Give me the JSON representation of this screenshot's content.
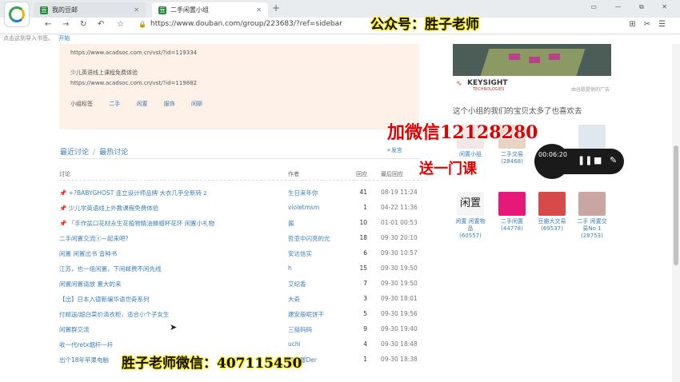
{
  "browser": {
    "tabs": [
      {
        "label": "我的豆邮",
        "favicon": "豆"
      },
      {
        "label": "二手闲置小组",
        "favicon": "豆"
      }
    ],
    "new_tab": "+",
    "window_controls": "▭ — ⧉ ✕",
    "url": "https://www.douban.com/group/223683/?ref=sidebar",
    "bookmarks_hint": "点击这到导入书签。",
    "bookmarks_start": "开始"
  },
  "promo": {
    "line1": "https://www.acadsoc.com.cn/vst/?id=119334",
    "line2": "少儿英语线上课程免费体验",
    "line3": "https://www.acadsoc.com.cn/vst/?id=119882",
    "tags_label": "小组标签",
    "tags": [
      "二手",
      "闲置",
      "服饰",
      "闲聊"
    ]
  },
  "post_link": "+发言",
  "discussions": {
    "tab_recent": "最近讨论",
    "tab_hot": "最热讨论",
    "columns": {
      "title": "讨论",
      "author": "作者",
      "replies": "回应",
      "last": "最后回应"
    },
    "rows": [
      {
        "title": "📌 +?BABYGHOST 连立设计师品牌 大衣几乎全新转 z",
        "author": "生日来年你",
        "replies": "41",
        "time": "08-19 11:24"
      },
      {
        "title": "📌 少儿学英语线上外教课程免费体验",
        "author": "violetmsm",
        "replies": "1",
        "time": "04-22 11:36"
      },
      {
        "title": "📌 「手作盆口花材永生花植物精油蜂蜡杯花环 闲置小礼物",
        "author": "酱",
        "replies": "10",
        "time": "01-01 00:53"
      },
      {
        "title": "二手闲置交流ⓧ—起来吧?",
        "author": "哲亚中闪亮的光",
        "replies": "18",
        "time": "09-30 20:10"
      },
      {
        "title": "闲置 闲置出书 音种书",
        "author": "安达信实",
        "replies": "6",
        "time": "09-30 10:57"
      },
      {
        "title": "江苏，也一组闲置，下闲邮费不闲先线",
        "author": "h",
        "replies": "15",
        "time": "09-30 19:50"
      },
      {
        "title": "闲置闲置请放 置大的来",
        "author": "艾纪香",
        "replies": "7",
        "time": "09-30 19:50"
      },
      {
        "title": "【出】日本入德新编华语世奇系列",
        "author": "大奇",
        "replies": "3",
        "time": "09-30 18:01"
      },
      {
        "title": "付邮送/超白菜价清衣柜，适合小个子女生",
        "author": "建安般呢饼干",
        "replies": "5",
        "time": "09-30 19:56"
      },
      {
        "title": "闲置群交流",
        "author": "三摇码码",
        "replies": "9",
        "time": "09-30 19:40"
      },
      {
        "title": "收一代retx烟杆一杆",
        "author": "uchi",
        "replies": "4",
        "time": "09-30 18:48"
      },
      {
        "title": "出个18年苹果电脑",
        "author": "讯哇塞Der",
        "replies": "1",
        "time": "09-30 18:38"
      }
    ]
  },
  "ad": {
    "brand": "KEYSIGHT",
    "brand_sub": "TECHNOLOGIES",
    "label": "由谷歌提供的广告"
  },
  "fav_heading": "这个小组的我们的宝贝太多了也喜欢去",
  "groups": [
    {
      "name": "闲置小组",
      "count": ""
    },
    {
      "name": "二手交易",
      "count": "(28468)"
    },
    {
      "name": "",
      "count": ""
    },
    {
      "name": "闲置 闲置物品",
      "count": "(60557)"
    },
    {
      "name": "二手闲置",
      "count": "(44778)"
    },
    {
      "name": "豆瓣大交易",
      "count": "(69537)"
    },
    {
      "name": "二手 闲置交易No 1",
      "count": "(28753)"
    }
  ],
  "player": {
    "time": "00:06:20"
  },
  "overlays": {
    "account": "公众号：胜子老师",
    "wechat": "加微信12128280",
    "gift": "送一门课",
    "teacher": "胜子老师微信：407115450"
  },
  "colors": {
    "link": "#3d7fb8",
    "promo_bg": "#fdf1e8",
    "overlay_red": "#e00000",
    "overlay_yellow": "#ffeb00"
  }
}
